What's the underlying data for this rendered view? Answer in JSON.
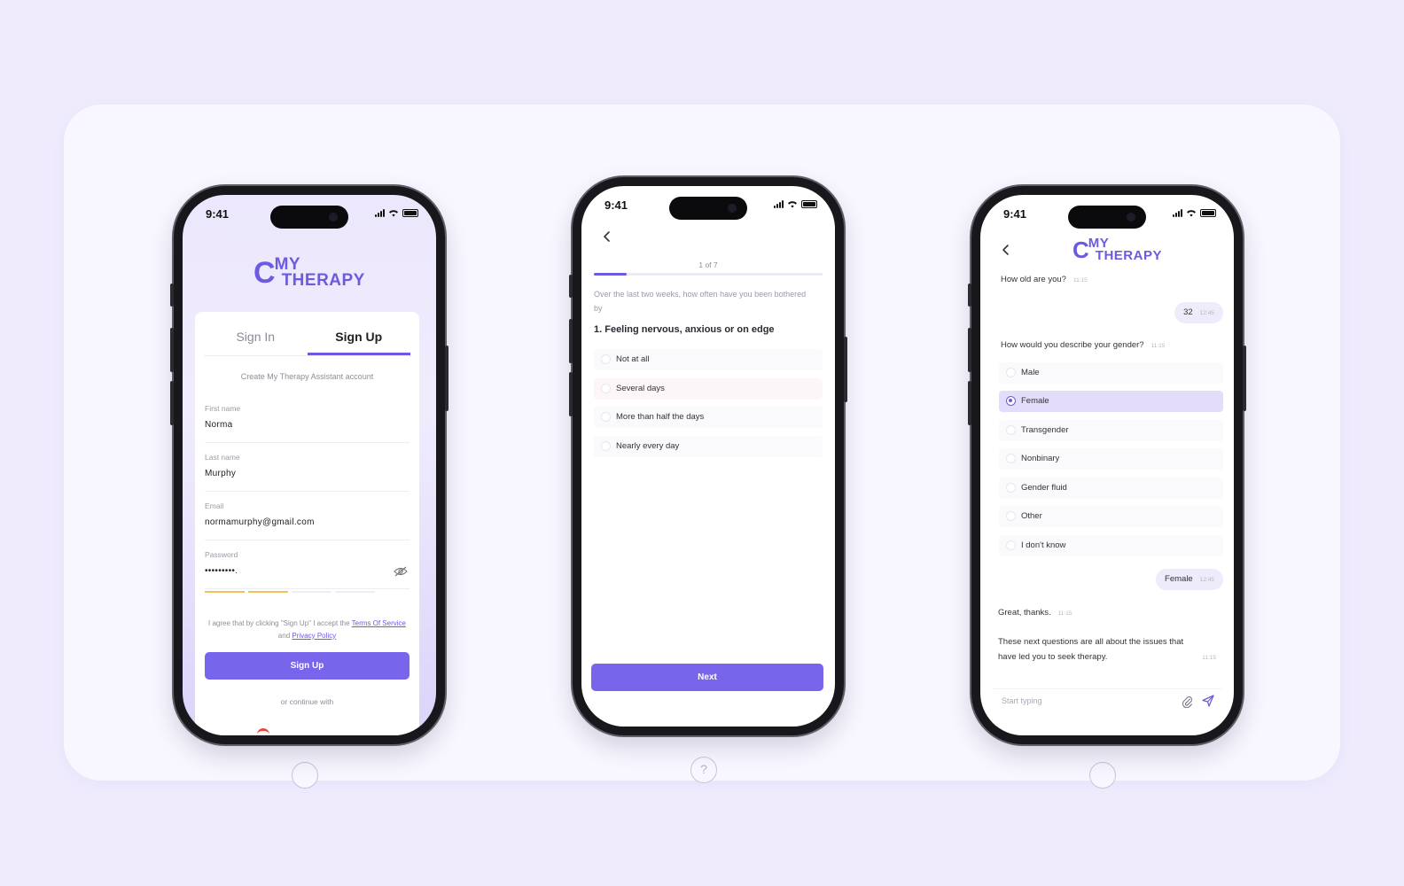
{
  "statusbar": {
    "time": "9:41"
  },
  "logo": {
    "line1": "MY",
    "line2": "THERAPY",
    "mark": "C"
  },
  "signup": {
    "tab_signin": "Sign In",
    "tab_signup": "Sign Up",
    "subtitle": "Create My Therapy Assistant account",
    "fields": [
      {
        "label": "First name",
        "value": "Norma"
      },
      {
        "label": "Last name",
        "value": "Murphy"
      },
      {
        "label": "Email",
        "value": "normamurphy@gmail.com"
      },
      {
        "label": "Password",
        "value": "•••••••••."
      }
    ],
    "password_strength_segments_filled": 2,
    "password_strength_segments_total": 4,
    "terms_prefix": "I agree that by clicking \"Sign Up\" I accept the",
    "terms_link": "Terms Of Service",
    "terms_and": "and",
    "privacy_link": "Privacy Policy",
    "button": "Sign Up",
    "or_continue": "or continue with",
    "eye_icon": "eye-off-icon"
  },
  "questionnaire": {
    "progress_label": "1 of 7",
    "progress_fraction": 0.143,
    "intro": "Over the last two weeks, how often have you been bothered by",
    "question": "1. Feeling nervous, anxious or on edge",
    "options": [
      "Not at all",
      "Several days",
      "More than half the days",
      "Nearly every day"
    ],
    "next_button": "Next"
  },
  "chat": {
    "q_age": "How old are you?",
    "q_age_time": "11:15",
    "a_age": "32",
    "a_age_time": "12:45",
    "q_gender": "How would you describe your gender?",
    "q_gender_time": "11:15",
    "gender_options": [
      "Male",
      "Female",
      "Transgender",
      "Nonbinary",
      "Gender fluid",
      "Other",
      "I don't know"
    ],
    "selected_gender": "Female",
    "a_gender": "Female",
    "a_gender_time": "12:45",
    "thanks": "Great, thanks.",
    "thanks_time": "11:15",
    "next_msg": "These next questions are all about the issues that have led you to seek therapy.",
    "next_msg_time": "11:15",
    "composer_placeholder": "Start typing"
  },
  "colors": {
    "accent": "#6b5be0",
    "button": "#7765ec",
    "page_bg": "#efebfd"
  }
}
